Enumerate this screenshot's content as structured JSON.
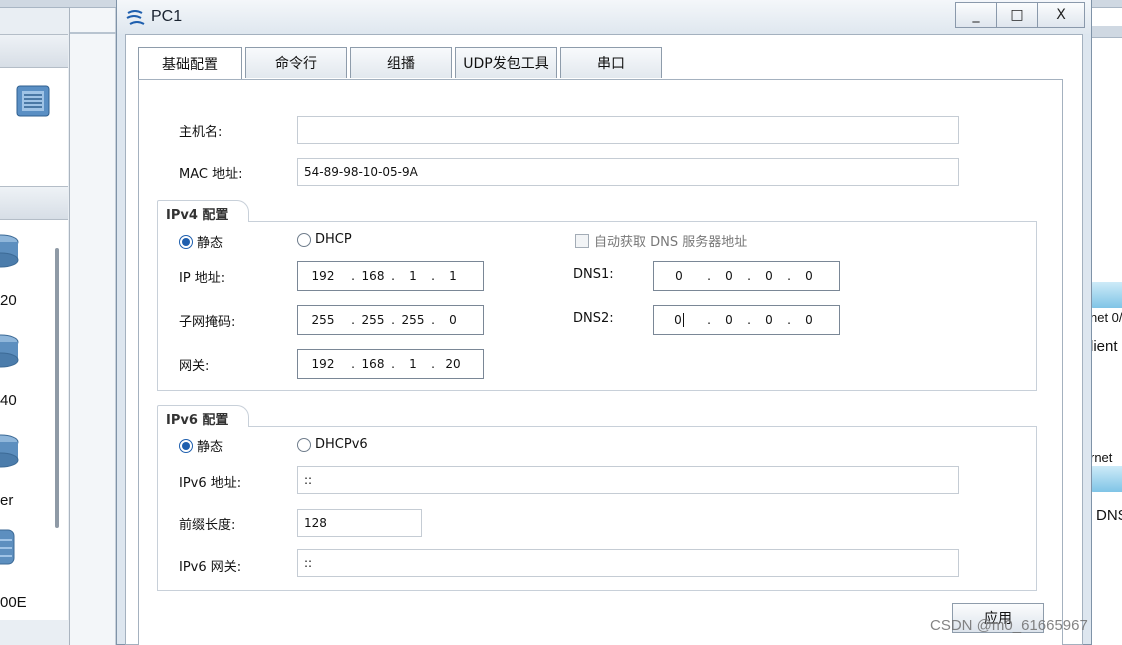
{
  "background": {
    "device_labels": [
      "20",
      "40",
      "er",
      "00E"
    ],
    "right_labels": [
      "net 0/",
      "lient",
      "rnet",
      "DNS"
    ]
  },
  "window": {
    "title": "PC1",
    "minimize_glyph": "_",
    "maximize_glyph": "□",
    "close_glyph": "X"
  },
  "tabs": [
    {
      "label": "基础配置",
      "active": true
    },
    {
      "label": "命令行",
      "active": false
    },
    {
      "label": "组播",
      "active": false
    },
    {
      "label": "UDP发包工具",
      "active": false
    },
    {
      "label": "串口",
      "active": false
    }
  ],
  "basic": {
    "hostname_label": "主机名:",
    "hostname_value": "",
    "mac_label": "MAC 地址:",
    "mac_value": "54-89-98-10-05-9A"
  },
  "ipv4": {
    "section_title": "IPv4 配置",
    "static_label": "静态",
    "dhcp_label": "DHCP",
    "auto_dns_label": "自动获取 DNS 服务器地址",
    "ip_label": "IP 地址:",
    "ip": [
      "192",
      "168",
      "1",
      "1"
    ],
    "mask_label": "子网掩码:",
    "mask": [
      "255",
      "255",
      "255",
      "0"
    ],
    "gateway_label": "网关:",
    "gateway": [
      "192",
      "168",
      "1",
      "20"
    ],
    "dns1_label": "DNS1:",
    "dns1": [
      "0",
      "0",
      "0",
      "0"
    ],
    "dns2_label": "DNS2:",
    "dns2": [
      "0",
      "0",
      "0",
      "0"
    ]
  },
  "ipv6": {
    "section_title": "IPv6 配置",
    "static_label": "静态",
    "dhcp_label": "DHCPv6",
    "ip_label": "IPv6 地址:",
    "ip_value": "::",
    "prefix_label": "前缀长度:",
    "prefix_value": "128",
    "gateway_label": "IPv6 网关:",
    "gateway_value": "::"
  },
  "apply_label": "应用",
  "watermark": "CSDN @m0_61665967"
}
